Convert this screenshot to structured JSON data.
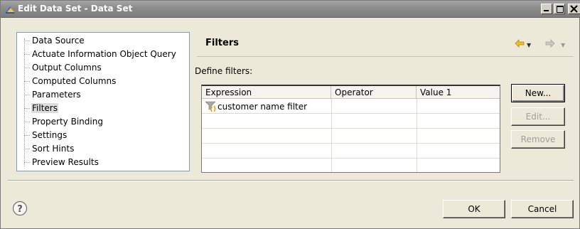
{
  "window": {
    "title": "Edit Data Set - Data Set"
  },
  "tree": {
    "selected": "Filters",
    "items": [
      {
        "label": "Data Source"
      },
      {
        "label": "Actuate Information Object Query"
      },
      {
        "label": "Output Columns"
      },
      {
        "label": "Computed Columns"
      },
      {
        "label": "Parameters"
      },
      {
        "label": "Filters"
      },
      {
        "label": "Property Binding"
      },
      {
        "label": "Settings"
      },
      {
        "label": "Sort Hints"
      },
      {
        "label": "Preview Results"
      }
    ]
  },
  "panel": {
    "title": "Filters",
    "define_label": "Define filters:"
  },
  "table": {
    "columns": [
      "Expression",
      "Operator",
      "Value 1"
    ],
    "rows": [
      {
        "expression": "customer name filter",
        "operator": "",
        "value1": ""
      }
    ]
  },
  "buttons": {
    "new": "New...",
    "edit": "Edit...",
    "remove": "Remove",
    "ok": "OK",
    "cancel": "Cancel"
  },
  "icons": {
    "window_icon": "data-set-icon",
    "back": "back-arrow-icon",
    "forward": "forward-arrow-icon",
    "help": "help-icon",
    "filter": "filter-expression-icon"
  },
  "colors": {
    "back_arrow": "#f0c020",
    "forward_arrow": "#a0a0a0",
    "tree_border": "#7f9db9"
  }
}
